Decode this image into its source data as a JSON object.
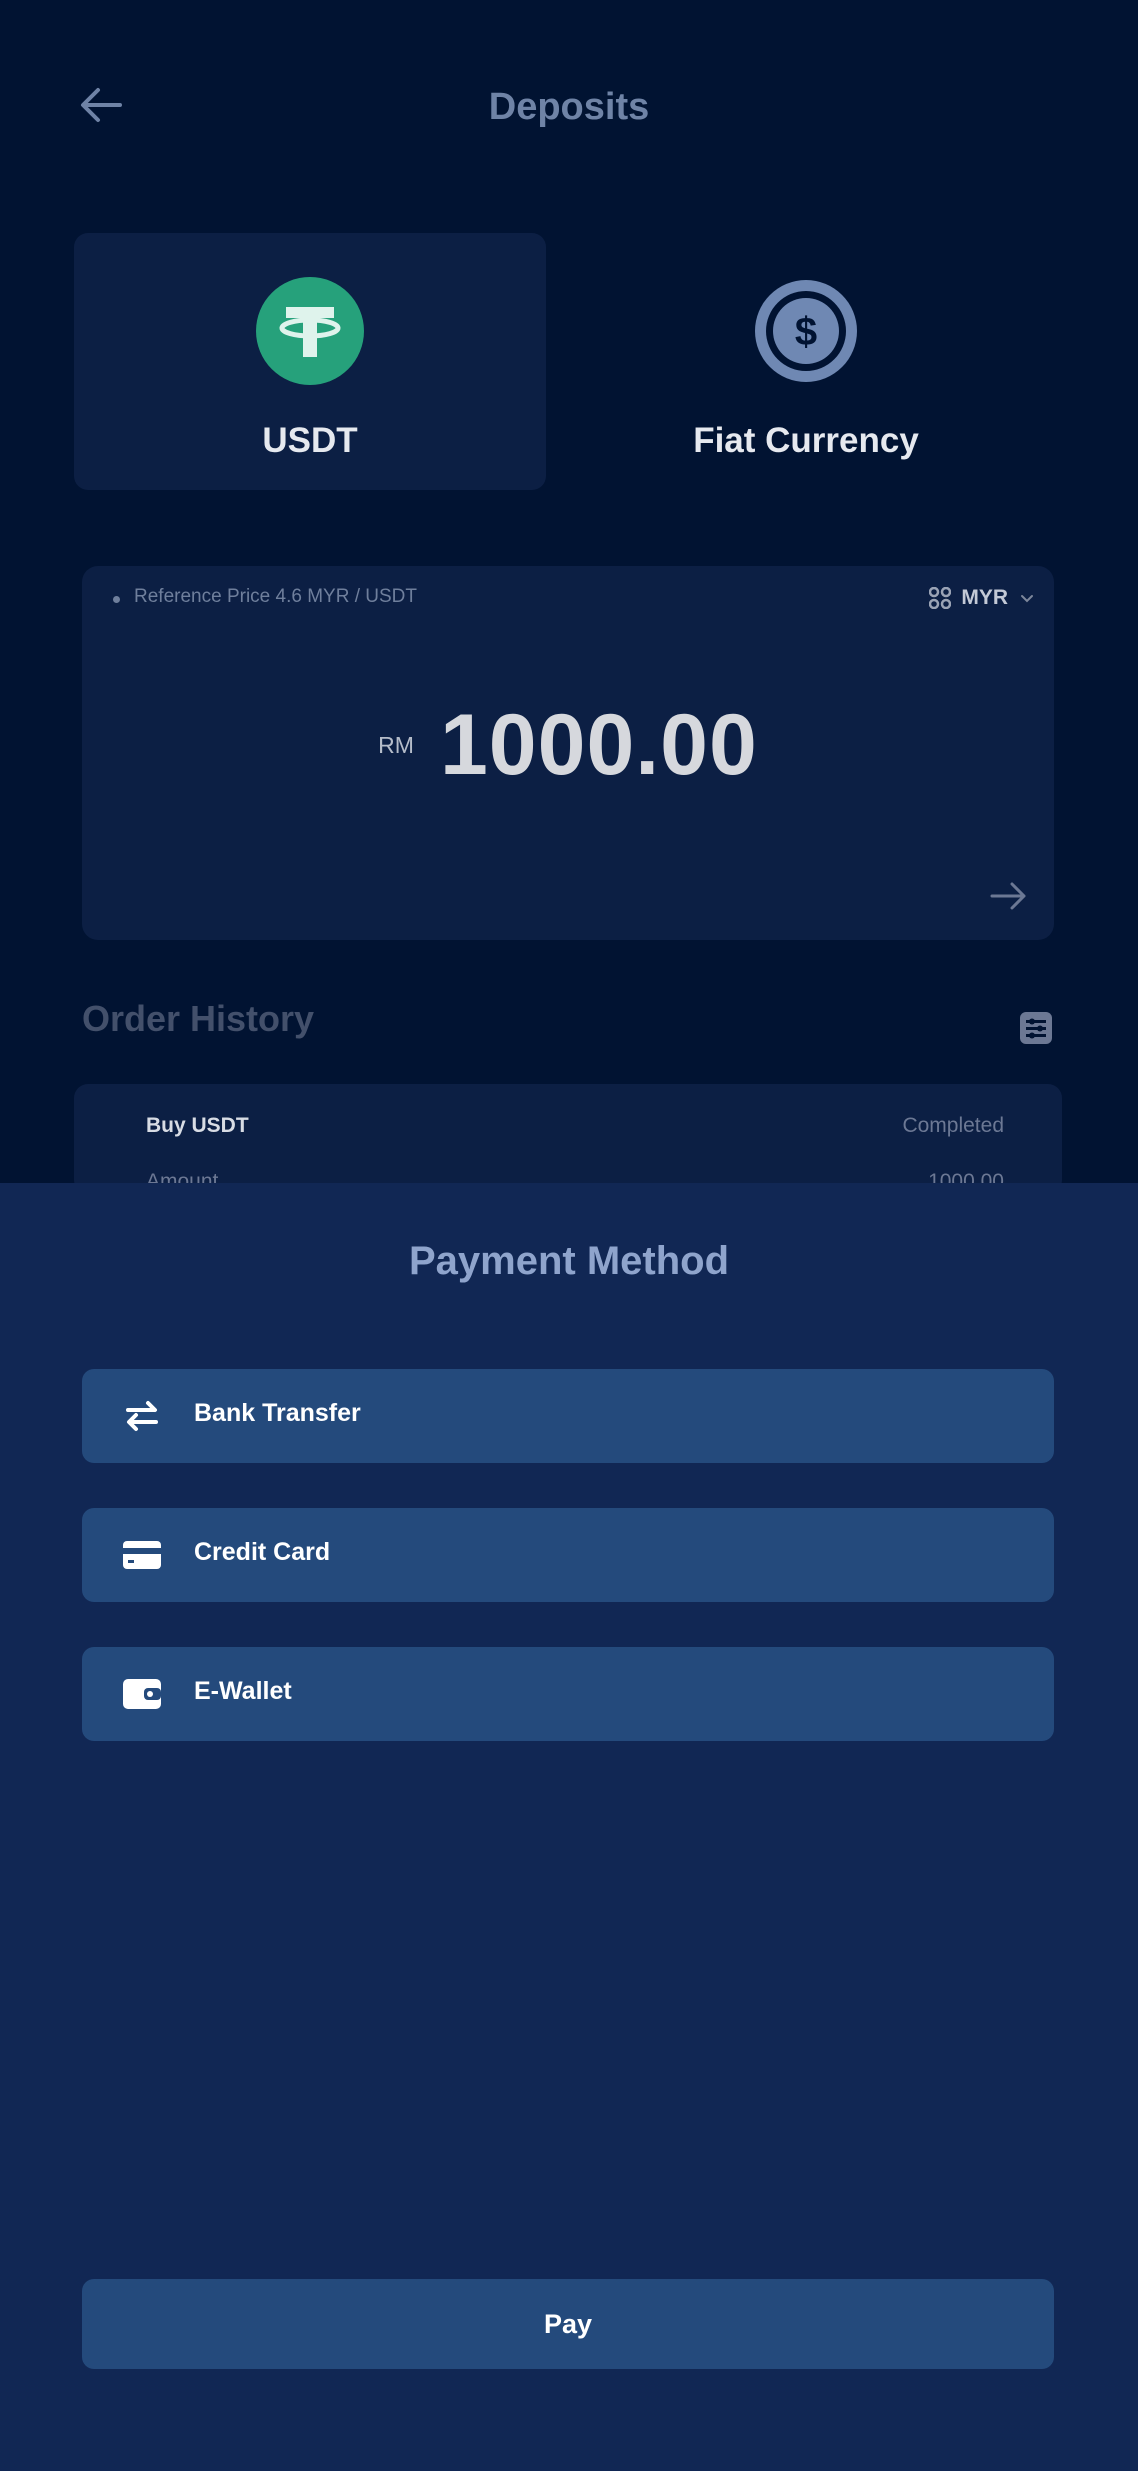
{
  "header": {
    "title": "Deposits",
    "back_icon": "arrow-left-icon"
  },
  "tabs": [
    {
      "label": "USDT",
      "icon": "tether-icon",
      "selected": true
    },
    {
      "label": "Fiat Currency",
      "icon": "dollar-coin-icon",
      "selected": false
    }
  ],
  "amount_card": {
    "reference_price": "Reference Price 4.6 MYR / USDT",
    "currency_code": "MYR",
    "currency_prefix": "RM",
    "amount": "1000.00"
  },
  "order_history": {
    "title": "Order History",
    "orders": [
      {
        "type": "Buy USDT",
        "status": "Completed",
        "label": "Amount",
        "amount": "1000.00"
      }
    ]
  },
  "payment_sheet": {
    "title": "Payment Method",
    "methods": [
      {
        "label": "Bank Transfer",
        "icon": "transfer-arrows-icon"
      },
      {
        "label": "Credit Card",
        "icon": "credit-card-icon"
      },
      {
        "label": "E-Wallet",
        "icon": "wallet-icon"
      }
    ],
    "pay_label": "Pay"
  },
  "colors": {
    "background": "#011332",
    "card": "#0c1f44",
    "sheet": "#112754",
    "button": "#244a7c",
    "tether_green": "#26a17b",
    "muted_text": "#6f83a6"
  }
}
